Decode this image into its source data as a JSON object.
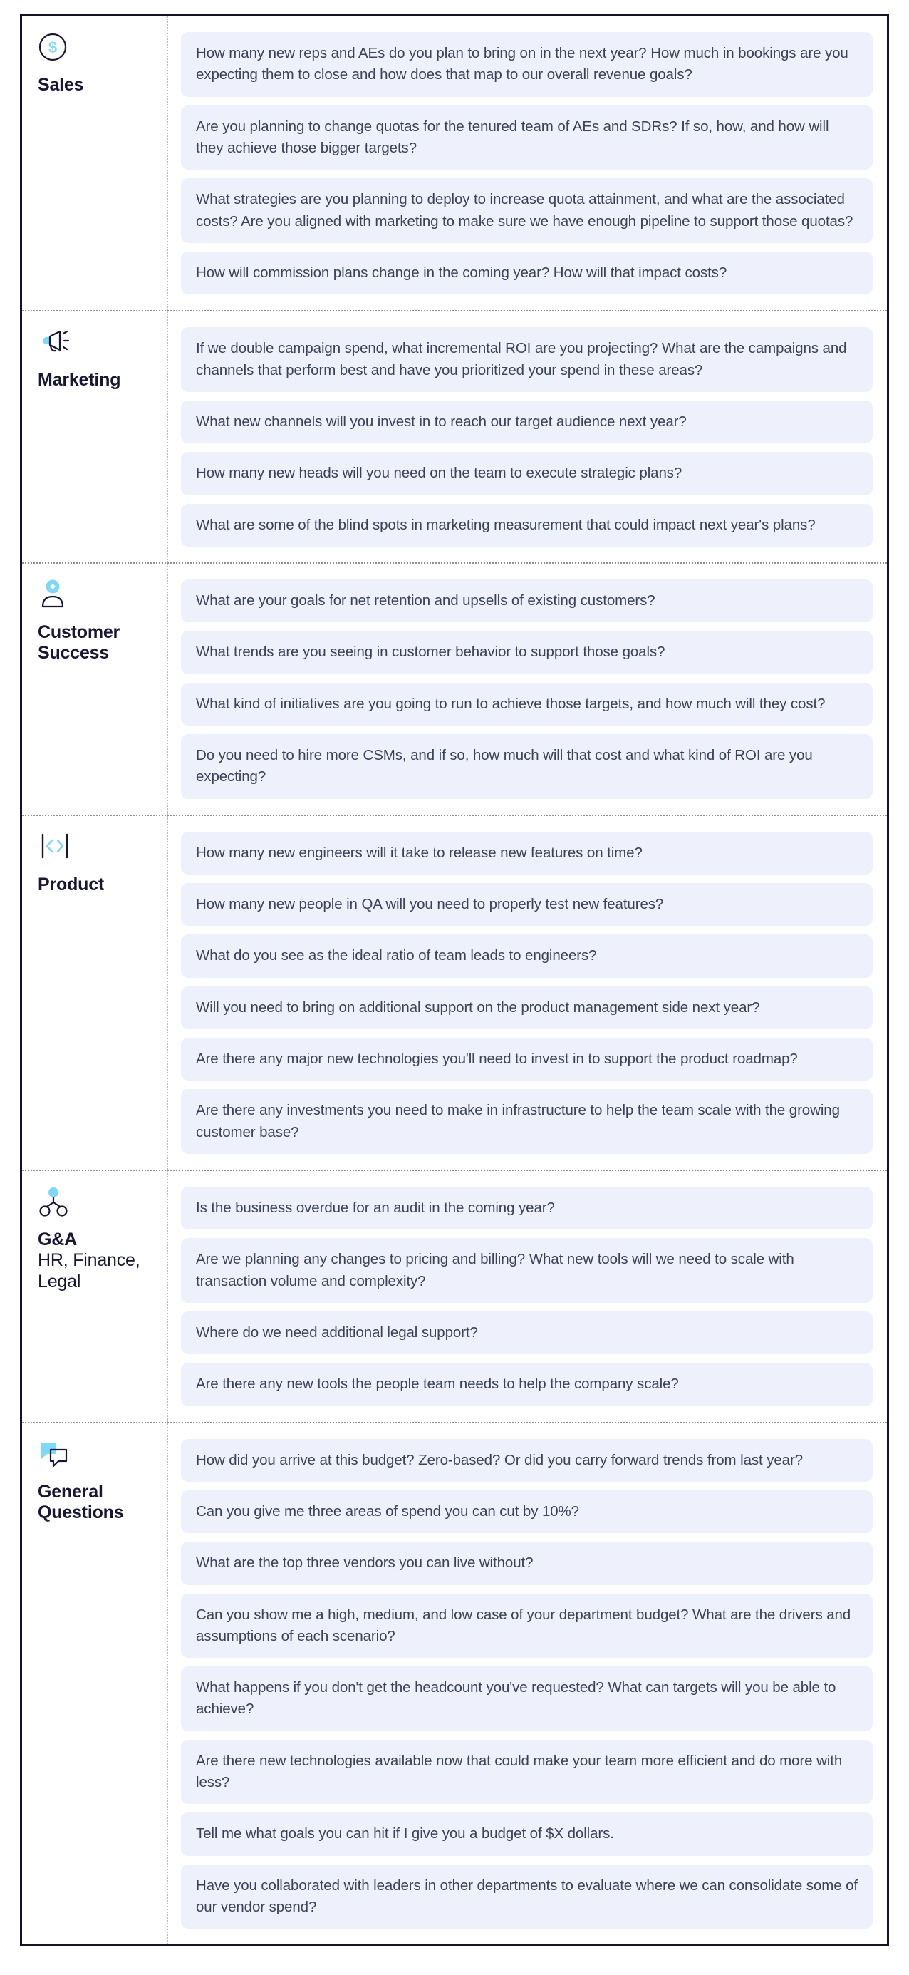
{
  "sections": [
    {
      "icon": "dollar-circle-icon",
      "title": "Sales",
      "subtitle": "",
      "questions": [
        "How many new reps and AEs do you plan to bring on in the next year? How much in bookings are you expecting them to close and how does that map to our overall revenue goals?",
        "Are you planning to change quotas for the tenured team of AEs and SDRs? If so, how, and how will they achieve those bigger targets?",
        "What strategies are you planning to deploy to increase quota attainment, and what are the associated costs? Are you aligned with marketing to make sure we have enough pipeline to support those quotas?",
        "How will commission plans change in the coming year? How will that impact costs?"
      ]
    },
    {
      "icon": "megaphone-icon",
      "title": "Marketing",
      "subtitle": "",
      "questions": [
        "If we double campaign spend, what incremental ROI are you projecting? What are the campaigns and channels that perform best and have you prioritized your spend in these areas?",
        "What new channels will you invest in to reach our target audience next year?",
        "How many new heads will you need on the team to execute strategic plans?",
        "What are some of the blind spots in marketing measurement that could impact next year's plans?"
      ]
    },
    {
      "icon": "user-icon",
      "title": "Customer Success",
      "subtitle": "",
      "questions": [
        "What are your goals for net retention and upsells of existing customers?",
        "What trends are you seeing in customer behavior to support those goals?",
        "What kind of initiatives are you going to run to achieve those targets, and how much will they cost?",
        "Do you need to hire more CSMs, and if so, how much will that cost and what kind of ROI are you expecting?"
      ]
    },
    {
      "icon": "code-brackets-icon",
      "title": "Product",
      "subtitle": "",
      "questions": [
        "How many new engineers will it take to release new features on time?",
        "How many new people in QA will you need to properly test new features?",
        "What do you see as the ideal ratio of team leads to engineers?",
        "Will you need to bring on additional support on the product management side next year?",
        "Are there any major new technologies you'll need to invest in to support the product roadmap?",
        "Are there any investments you need to make in infrastructure to help the team scale with the growing customer base?"
      ]
    },
    {
      "icon": "org-chart-icon",
      "title": "G&A",
      "subtitle": "HR, Finance, Legal",
      "questions": [
        "Is the business overdue for an audit in the coming year?",
        "Are we planning any changes to pricing and billing? What new tools will we need to scale with transaction volume and complexity?",
        "Where do we need additional legal support?",
        "Are there any new tools the people team needs to help the company scale?"
      ]
    },
    {
      "icon": "chat-bubbles-icon",
      "title": "General Questions",
      "subtitle": "",
      "questions": [
        "How did you arrive at this budget? Zero-based? Or did you carry forward trends from last year?",
        "Can you give me three areas of spend you can cut by 10%?",
        "What are the top three vendors you can live without?",
        "Can you show me a high, medium, and low case of your department budget? What are the drivers and assumptions of each scenario?",
        "What happens if you don't get the headcount you've requested? What can targets will you be able to achieve?",
        "Are there new technologies available now that could make your team more efficient and do more with less?",
        "Tell me what goals you can hit if I give you a budget of $X dollars.",
        "Have you collaborated with leaders in other departments to evaluate where we can consolidate some of our vendor spend?"
      ]
    }
  ],
  "colors": {
    "accent": "#7fd8f7",
    "ink": "#181733",
    "bubble_bg": "#eef1fb",
    "bubble_text": "#3b4257",
    "border": "#141325"
  }
}
